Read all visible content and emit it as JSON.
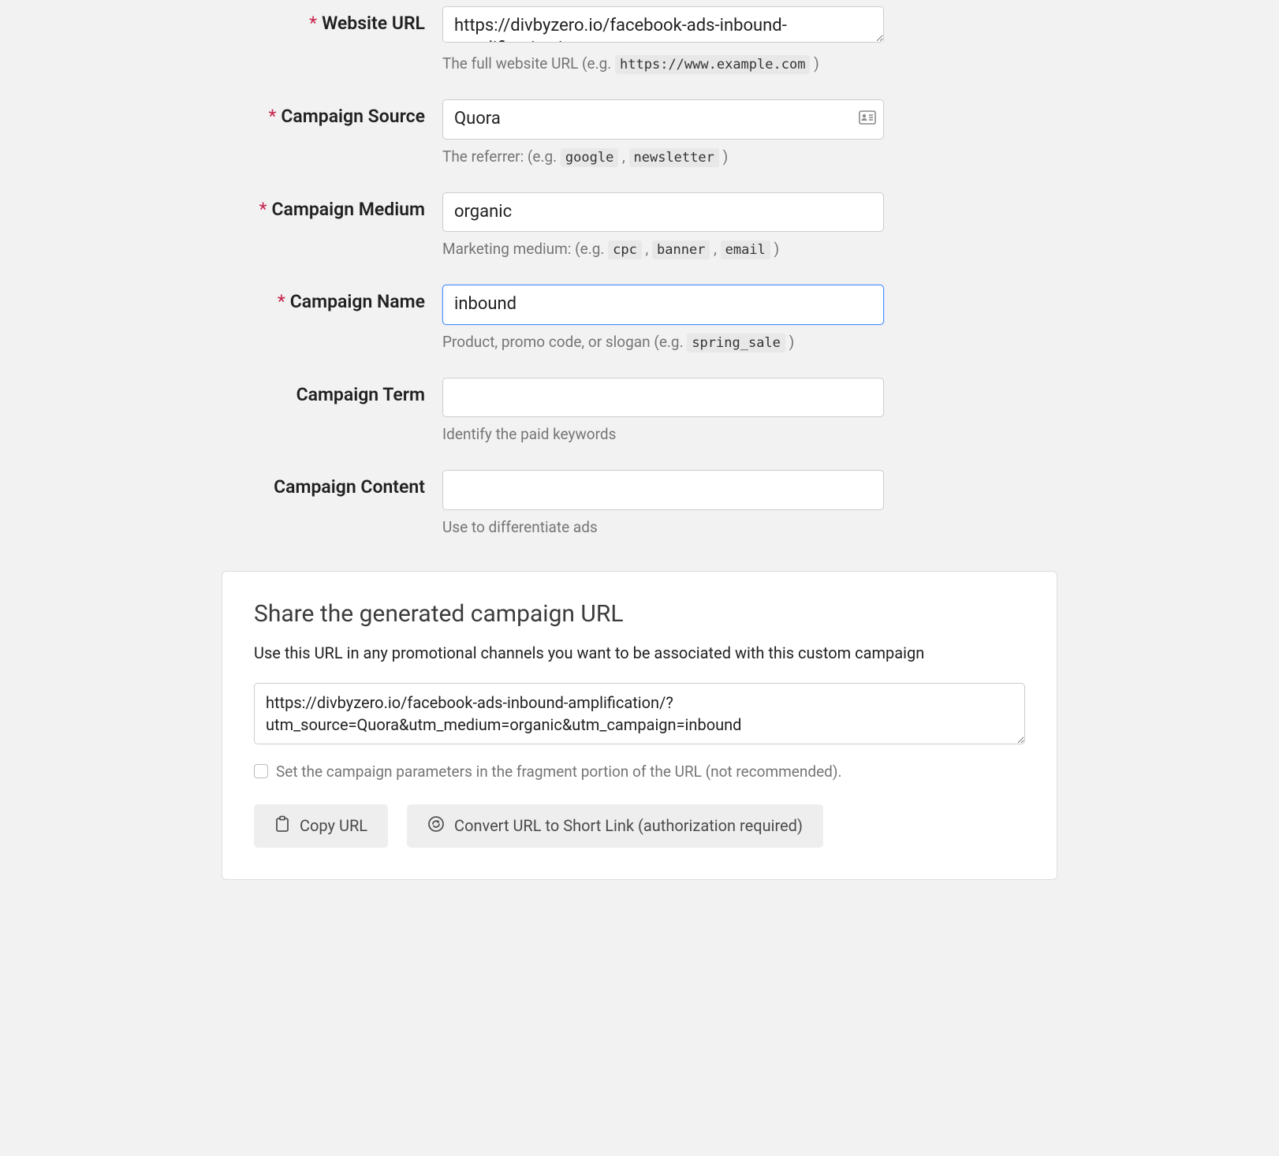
{
  "form": {
    "website_url": {
      "label": "Website URL",
      "required": true,
      "value": "https://divbyzero.io/facebook-ads-inbound-amplification/",
      "helper_prefix": "The full website URL (e.g. ",
      "helper_code": "https://www.example.com",
      "helper_suffix": " )"
    },
    "campaign_source": {
      "label": "Campaign Source",
      "required": true,
      "value": "Quora",
      "helper_prefix": "The referrer: (e.g. ",
      "helper_code1": "google",
      "helper_sep": " , ",
      "helper_code2": "newsletter",
      "helper_suffix": " )"
    },
    "campaign_medium": {
      "label": "Campaign Medium",
      "required": true,
      "value": "organic",
      "helper_prefix": "Marketing medium: (e.g. ",
      "helper_code1": "cpc",
      "helper_sep": " , ",
      "helper_code2": "banner",
      "helper_sep2": " , ",
      "helper_code3": "email",
      "helper_suffix": " )"
    },
    "campaign_name": {
      "label": "Campaign Name",
      "required": true,
      "value": "inbound",
      "helper_prefix": "Product, promo code, or slogan (e.g. ",
      "helper_code": "spring_sale",
      "helper_suffix": " )"
    },
    "campaign_term": {
      "label": "Campaign Term",
      "required": false,
      "value": "",
      "helper": "Identify the paid keywords"
    },
    "campaign_content": {
      "label": "Campaign Content",
      "required": false,
      "value": "",
      "helper": "Use to differentiate ads"
    }
  },
  "share": {
    "title": "Share the generated campaign URL",
    "subtitle": "Use this URL in any promotional channels you want to be associated with this custom campaign",
    "generated_url": "https://divbyzero.io/facebook-ads-inbound-amplification/?utm_source=Quora&utm_medium=organic&utm_campaign=inbound",
    "fragment_checkbox_label": "Set the campaign parameters in the fragment portion of the URL (not recommended).",
    "copy_button": "Copy URL",
    "shorten_button": "Convert URL to Short Link (authorization required)"
  }
}
